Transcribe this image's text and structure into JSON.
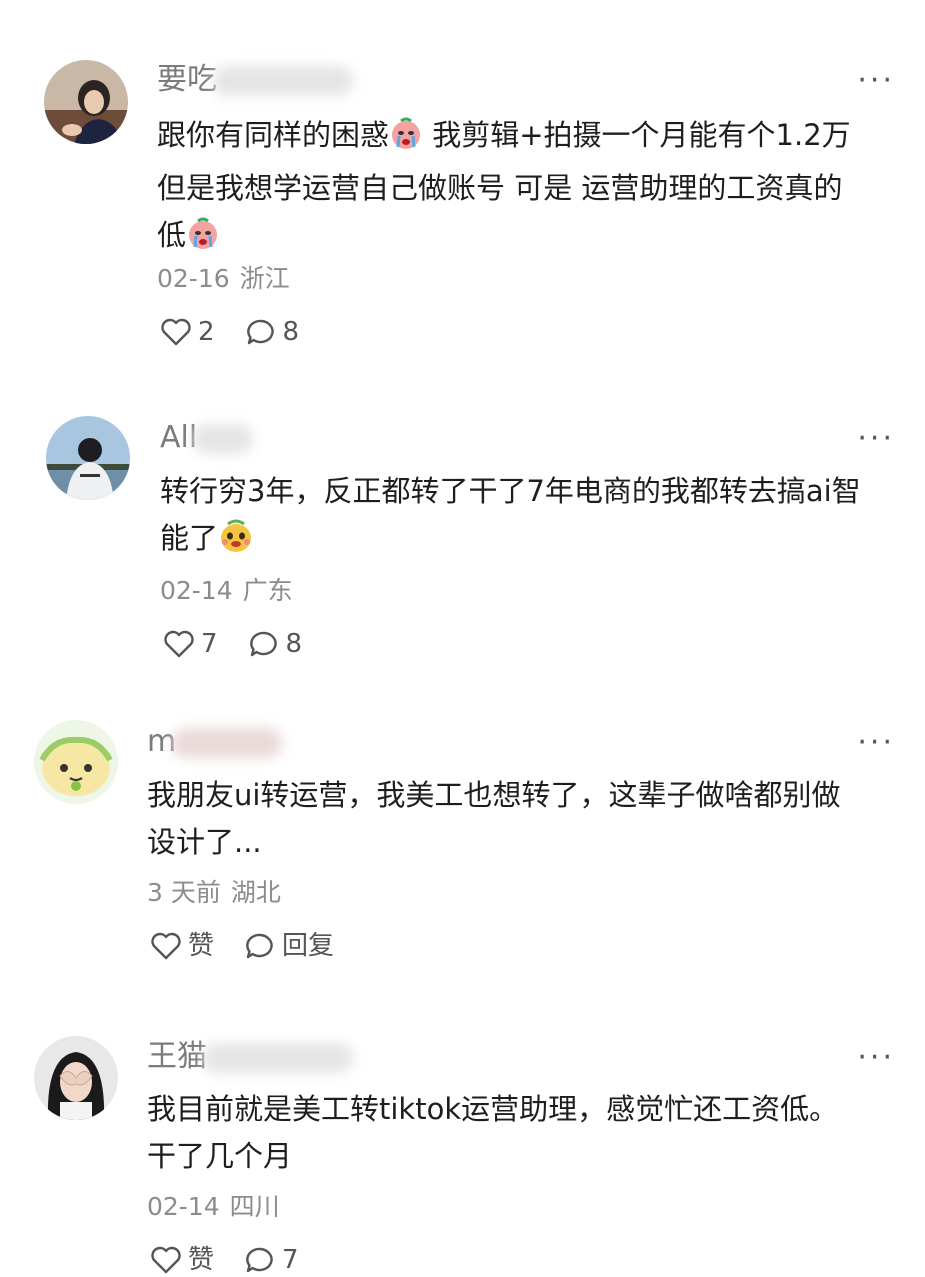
{
  "more_glyph": "···",
  "comments": [
    {
      "username": "要吃",
      "text_lines": [
        "跟你有同样的困惑",
        "我剪辑+拍摄一个月能有个1.2万",
        "但是我想学运营自己做账号 可是 运营助理的工资真的",
        "低"
      ],
      "date": "02-16",
      "location": "浙江",
      "likes": "2",
      "replies": "8"
    },
    {
      "username": "All",
      "text_lines": [
        "转行穷3年，反正都转了干了7年电商的我都转去搞ai智",
        "能了"
      ],
      "date": "02-14",
      "location": "广东",
      "likes": "7",
      "replies": "8"
    },
    {
      "username": "m",
      "text_lines": [
        "我朋友ui转运营，我美工也想转了，这辈子做啥都别做",
        "设计了..."
      ],
      "date": "3 天前",
      "location": "湖北",
      "likes": "赞",
      "replies": "回复"
    },
    {
      "username": "王猫",
      "text_lines": [
        "我目前就是美工转tiktok运营助理，感觉忙还工资低。",
        "干了几个月"
      ],
      "date": "02-14",
      "location": "四川",
      "likes": "赞",
      "replies": "7"
    }
  ],
  "colors": {
    "username": "#7b7b7b",
    "text": "#1e1e1e",
    "meta": "#8c8c8c",
    "action": "#555555"
  },
  "icons": [
    "heart-icon",
    "comment-icon",
    "more-icon",
    "crying-emoji",
    "smirk-emoji"
  ]
}
